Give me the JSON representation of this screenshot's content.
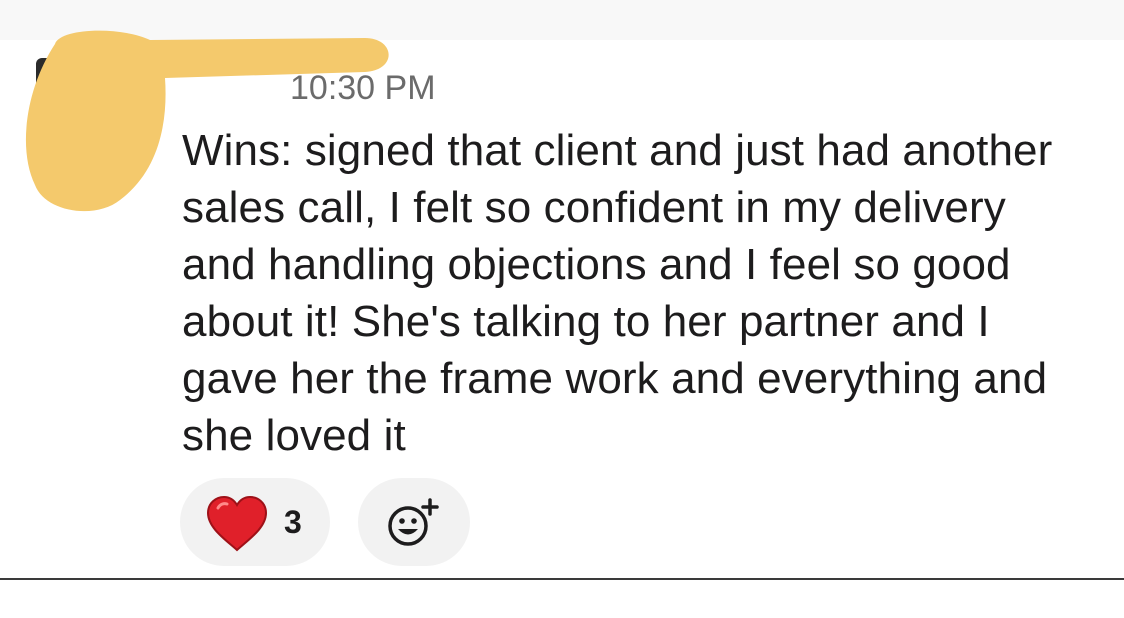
{
  "message": {
    "timestamp": "10:30 PM",
    "text": "Wins: signed that client and just had another sales call, I felt so confident in my delivery and handling objections and I feel so good about it! She's talking to her partner and I gave her the frame work and everything and she loved it",
    "reactions": [
      {
        "emoji": "heart-icon",
        "count": "3"
      }
    ],
    "add_reaction_icon": "add-reaction-icon"
  },
  "colors": {
    "redaction": "#f4c96c",
    "reaction_bg": "#f2f2f2",
    "heart": "#e0202a",
    "text": "#1d1c1d"
  }
}
